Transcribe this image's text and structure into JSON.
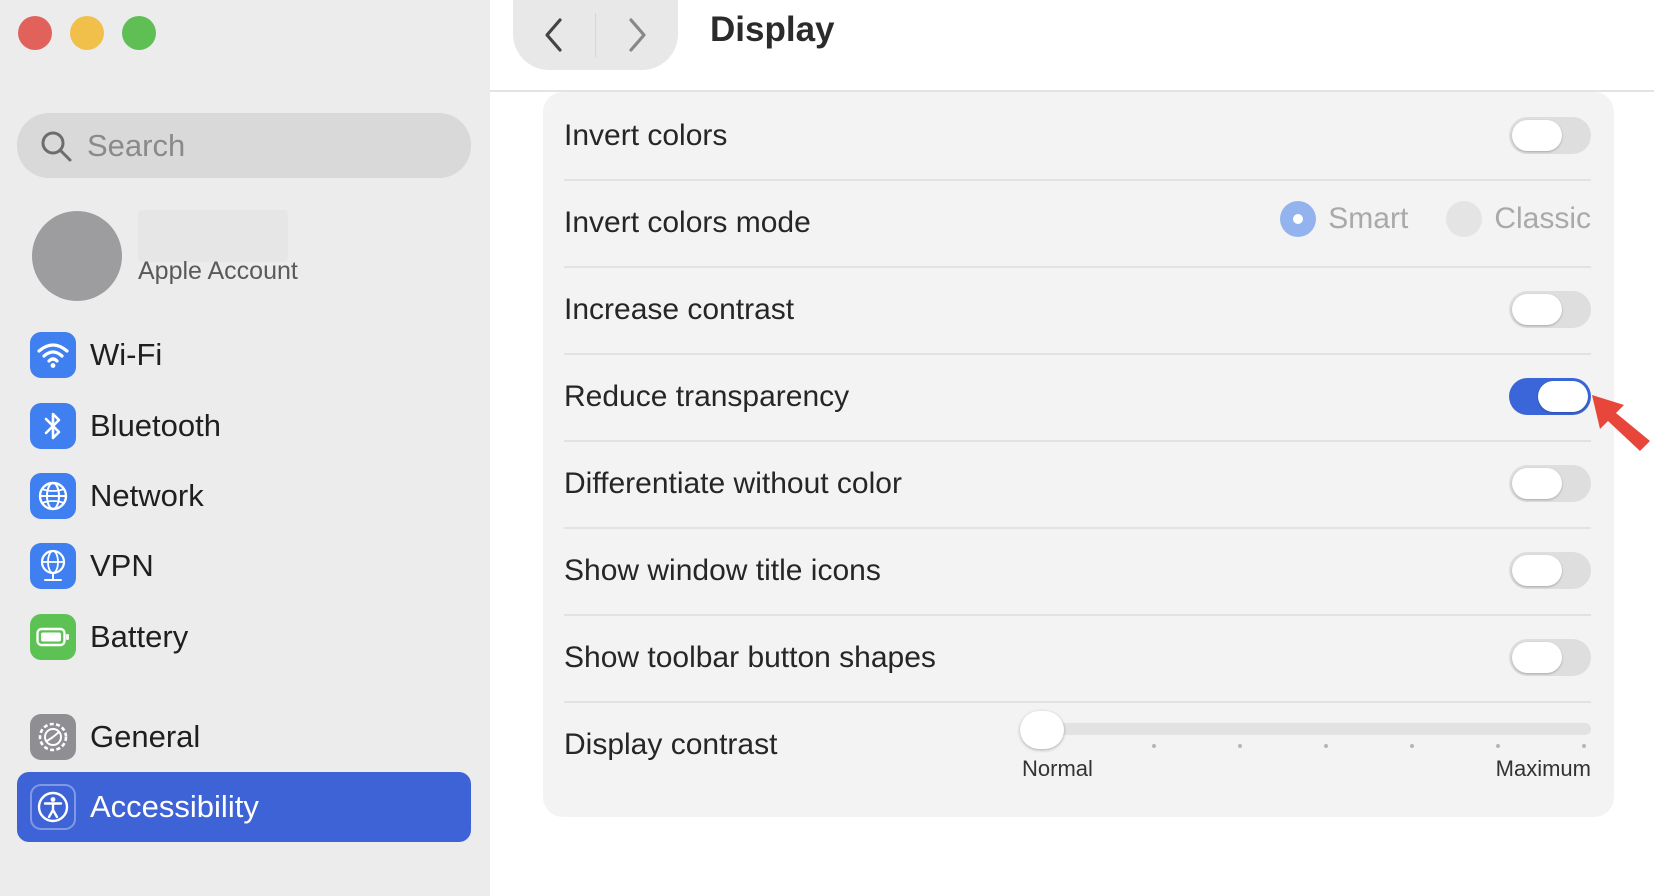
{
  "window": {
    "traffic_lights": {
      "close": "#e0625a",
      "minimize": "#f0c04a",
      "zoom": "#5fbf55"
    }
  },
  "sidebar": {
    "search_placeholder": "Search",
    "account_label": "Apple Account",
    "items": [
      {
        "label": "Wi-Fi",
        "icon": "wifi-icon",
        "color": "#3f7ff0"
      },
      {
        "label": "Bluetooth",
        "icon": "bluetooth-icon",
        "color": "#3f7ff0"
      },
      {
        "label": "Network",
        "icon": "globe-icon",
        "color": "#3f7ff0"
      },
      {
        "label": "VPN",
        "icon": "vpn-globe-icon",
        "color": "#3f7ff0"
      },
      {
        "label": "Battery",
        "icon": "battery-icon",
        "color": "#5dc254"
      },
      {
        "label": "General",
        "icon": "gear-icon",
        "color": "#8e8e93"
      },
      {
        "label": "Accessibility",
        "icon": "accessibility-icon",
        "color": "#3e63d6",
        "active": true
      }
    ]
  },
  "header": {
    "title": "Display",
    "back_icon": "chevron-left-icon",
    "forward_icon": "chevron-right-icon"
  },
  "settings": {
    "invert_colors": {
      "label": "Invert colors",
      "on": false
    },
    "invert_colors_mode": {
      "label": "Invert colors mode",
      "options": [
        "Smart",
        "Classic"
      ],
      "selected": "Smart"
    },
    "increase_contrast": {
      "label": "Increase contrast",
      "on": false
    },
    "reduce_transparency": {
      "label": "Reduce transparency",
      "on": true
    },
    "differentiate_without_color": {
      "label": "Differentiate without color",
      "on": false
    },
    "show_window_title_icons": {
      "label": "Show window title icons",
      "on": false
    },
    "show_toolbar_button_shapes": {
      "label": "Show toolbar button shapes",
      "on": false
    },
    "display_contrast": {
      "label": "Display contrast",
      "min_label": "Normal",
      "max_label": "Maximum",
      "value": 0
    }
  },
  "colors": {
    "accent": "#3a66d9",
    "annotation_arrow": "#e8463b"
  }
}
